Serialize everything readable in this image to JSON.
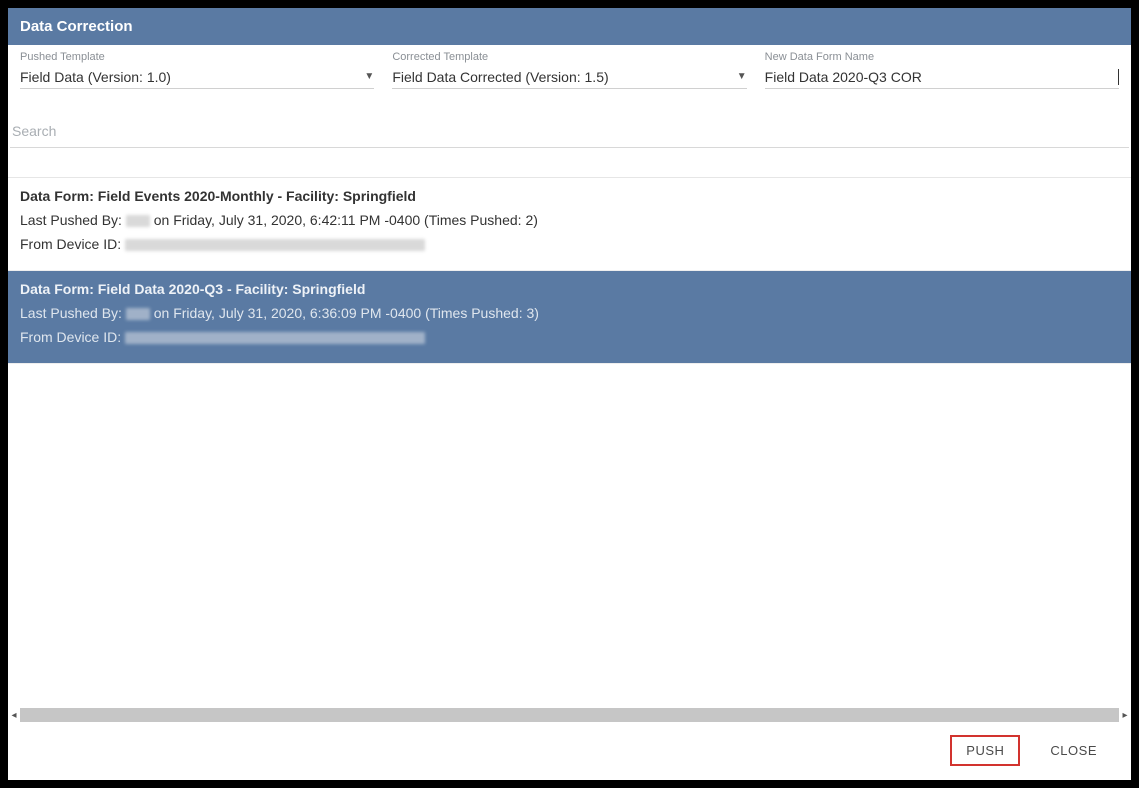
{
  "title": "Data Correction",
  "fields": {
    "pushed_template": {
      "label": "Pushed Template",
      "value": "Field Data (Version: 1.0)"
    },
    "corrected_template": {
      "label": "Corrected Template",
      "value": "Field Data Corrected (Version: 1.5)"
    },
    "new_data_form_name": {
      "label": "New Data Form Name",
      "value": "Field Data 2020-Q3 COR"
    }
  },
  "search": {
    "placeholder": "Search"
  },
  "items": [
    {
      "selected": false,
      "form_line": "Data Form: Field Events 2020-Monthly - Facility: Springfield",
      "pushed_prefix": "Last Pushed By: ",
      "pushed_suffix": " on Friday, July 31, 2020, 6:42:11 PM -0400 (Times Pushed: 2)",
      "device_prefix": "From Device ID: "
    },
    {
      "selected": true,
      "form_line": "Data Form: Field Data 2020-Q3 - Facility: Springfield",
      "pushed_prefix": "Last Pushed By: ",
      "pushed_suffix": " on Friday, July 31, 2020, 6:36:09 PM -0400 (Times Pushed: 3)",
      "device_prefix": "From Device ID: "
    }
  ],
  "footer": {
    "push": "PUSH",
    "close": "CLOSE"
  }
}
